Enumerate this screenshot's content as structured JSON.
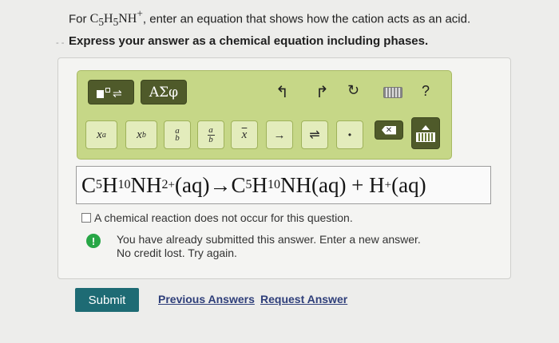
{
  "question": {
    "prefix": "For ",
    "formula_parts": [
      "C",
      "5",
      "H",
      "5",
      "NH",
      "+"
    ],
    "suffix": ", enter an equation that shows how the cation acts as an acid.",
    "instruction": "Express your answer as a chemical equation including phases."
  },
  "toolbar": {
    "row1": {
      "template_icon": "templates-icon",
      "greek_label": "ΑΣφ",
      "undo_icon": "undo-icon",
      "redo_icon": "redo-icon",
      "reset_icon": "reset-icon",
      "keyboard_icon": "keyboard-icon",
      "help_label": "?"
    },
    "row2": {
      "superscript_base": "x",
      "superscript_exp": "a",
      "subscript_base": "x",
      "subscript_sub": "b",
      "frac_num": "a",
      "frac_den": "b",
      "frac2_num": "a",
      "frac2_den": "b",
      "mean_label": "x",
      "arrow_label": "→",
      "equilibrium_label": "⇌",
      "dot_label": "•",
      "delete_icon": "delete-icon",
      "keyboard_toggle_icon": "keyboard-toggle-icon"
    }
  },
  "answer": {
    "parts": [
      "C",
      "5",
      "H",
      "10",
      "NH",
      "2",
      "+",
      "(aq)→C",
      "5",
      "H",
      "10",
      "NH(aq) + H",
      "+",
      "(aq)"
    ]
  },
  "no_reaction_label": "A chemical reaction does not occur for this question.",
  "feedback": {
    "icon": "exclamation-icon",
    "line1": "You have already submitted this answer. Enter a new answer.",
    "line2": "No credit lost. Try again."
  },
  "actions": {
    "submit_label": "Submit",
    "previous_answers_label": "Previous Answers",
    "request_answer_label": "Request Answer"
  },
  "colors": {
    "toolbar_bg": "#c6d787",
    "submit_bg": "#1e6b74",
    "feedback_icon": "#27a646"
  }
}
